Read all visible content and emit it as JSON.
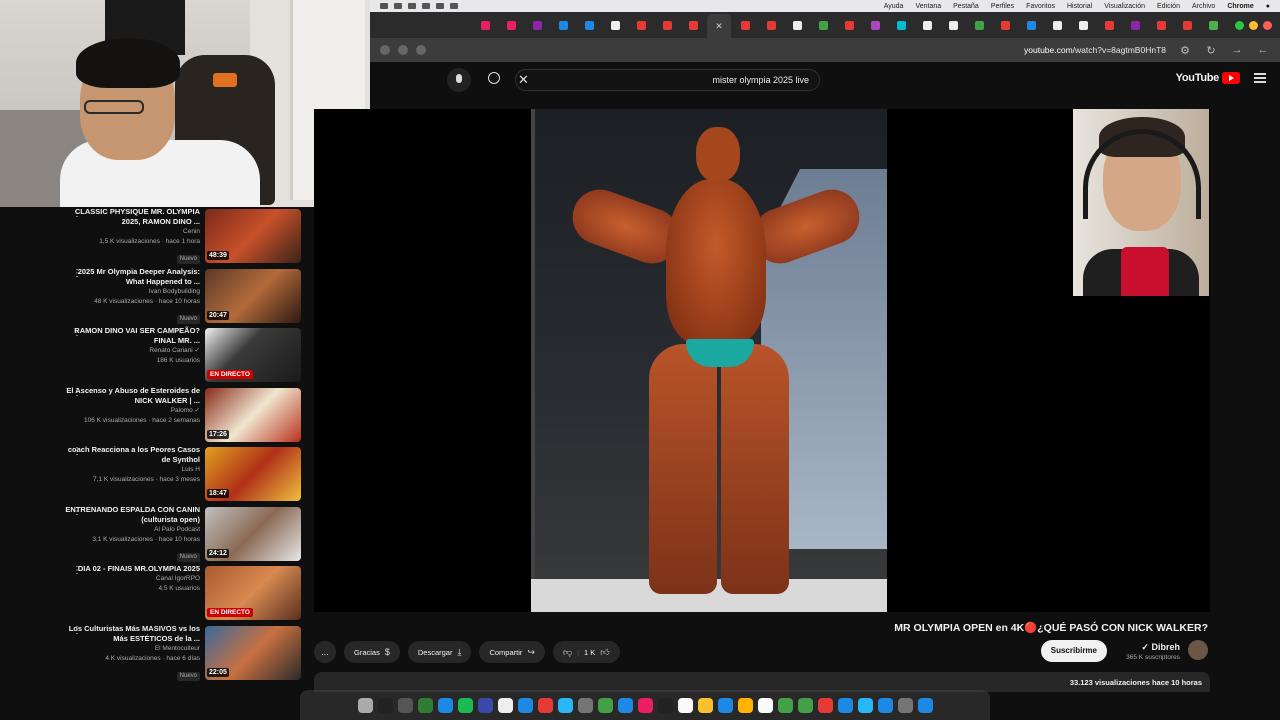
{
  "menubar": {
    "items": [
      "Chrome",
      "Archivo",
      "Edición",
      "Visualización",
      "Historial",
      "Favoritos",
      "Perfiles",
      "Pestaña",
      "Ventana",
      "Ayuda"
    ]
  },
  "browser": {
    "url_host": "youtube.com",
    "url_path": "/watch?v=8agtmB0HnT8"
  },
  "youtube": {
    "logo_text": "YouTube",
    "search_query": "mister olympia 2025 live"
  },
  "video": {
    "title": "MR OLYMPIA OPEN en 4K🔴¿QUÉ PASÓ CON NICK WALKER?",
    "channel_name": "Dibreh",
    "channel_verified": "✓",
    "subscribers": "365 K suscriptores",
    "subscribe_label": "Suscribirme",
    "likes": "1 K",
    "share_label": "Compartir",
    "download_label": "Descargar",
    "thanks_label": "Gracias",
    "more_label": "...",
    "stats": "33.123 visualizaciones  hace 10 horas"
  },
  "recommendations": [
    {
      "title": "CLASSIC PHYSIQUE MR. OLYMPIA 2025, RAMON DINO ...",
      "channel": "Cenin",
      "meta": "1,5 K visualizaciones · hace 1 hora",
      "badge": "Nuevo",
      "duration": "48:39",
      "live": ""
    },
    {
      "title": "2025 Mr Olympia Deeper Analysis: What Happened to ...",
      "channel": "Ivan Bodybuilding",
      "meta": "48 K visualizaciones · hace 10 horas",
      "badge": "Nuevo",
      "duration": "20:47",
      "live": ""
    },
    {
      "title": "RAMON DINO VAI SER CAMPEÃO? FINAL MR. ...",
      "channel": "Renato Cariani ✓",
      "meta": "186 K usuarios",
      "badge": "",
      "duration": "",
      "live": "EN DIRECTO"
    },
    {
      "title": "El Ascenso y Abuso de Esteroides de NICK WALKER | ...",
      "channel": "Palomo ✓",
      "meta": "106 K visualizaciones · hace 2 semanas",
      "badge": "",
      "duration": "17:26",
      "live": ""
    },
    {
      "title": "coach Reacciona a los Peores Casos de Synthol",
      "channel": "Luis H",
      "meta": "7,1 K visualizaciones · hace 3 meses",
      "badge": "",
      "duration": "18:47",
      "live": ""
    },
    {
      "title": "ENTRENANDO ESPALDA CON CANIN (culturista open)",
      "channel": "Al Palo Podcast",
      "meta": "3,1 K visualizaciones · hace 10 horas",
      "badge": "Nuevo",
      "duration": "24:12",
      "live": ""
    },
    {
      "title": "DIA 02 - FINAIS MR.OLYMPIA 2025",
      "channel": "Canal IgorRPO",
      "meta": "4,5 K usuarios",
      "badge": "",
      "duration": "",
      "live": "EN DIRECTO"
    },
    {
      "title": "Los Culturistas Más MASIVOS vs los Más ESTÉTICOS de la ...",
      "channel": "El Mentoculteur",
      "meta": "4 K visualizaciones · hace 6 días",
      "badge": "Nuevo",
      "duration": "22:05",
      "live": ""
    }
  ],
  "colors": {
    "background": "#0f0f0f",
    "youtube_red": "#ff0000",
    "live_red": "#cc0000",
    "pill": "#272727"
  }
}
